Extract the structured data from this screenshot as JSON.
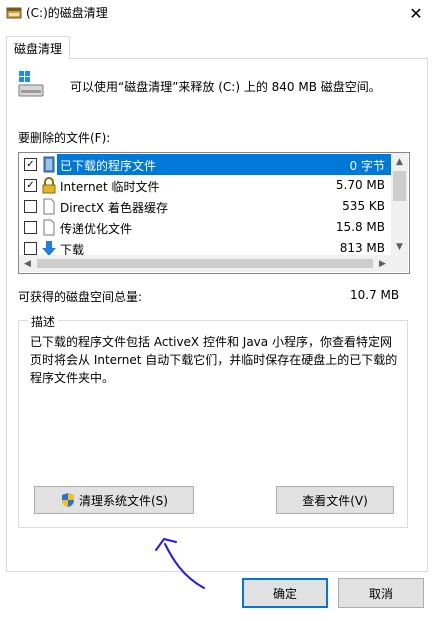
{
  "window": {
    "title": "(C:)的磁盘清理",
    "close_glyph": "✕"
  },
  "tabs": [
    {
      "label": "磁盘清理"
    }
  ],
  "header": {
    "text": "可以使用“磁盘清理”来释放 (C:) 上的 840 MB 磁盘空间。",
    "icon": "drive-icon"
  },
  "files": {
    "label": "要删除的文件(F):",
    "items": [
      {
        "name": "已下载的程序文件",
        "size": "0 字节",
        "checked": true,
        "selected": true,
        "icon": "folder-icon"
      },
      {
        "name": "Internet 临时文件",
        "size": "5.70 MB",
        "checked": true,
        "selected": false,
        "icon": "lock-icon"
      },
      {
        "name": "DirectX 着色器缓存",
        "size": "535 KB",
        "checked": false,
        "selected": false,
        "icon": "page-icon"
      },
      {
        "name": "传递优化文件",
        "size": "15.8 MB",
        "checked": false,
        "selected": false,
        "icon": "page-icon"
      },
      {
        "name": "下载",
        "size": "813 MB",
        "checked": false,
        "selected": false,
        "icon": "download-arrow-icon"
      }
    ]
  },
  "total": {
    "label": "可获得的磁盘空间总量:",
    "value": "10.7 MB"
  },
  "description": {
    "title": "描述",
    "text": "已下载的程序文件包括 ActiveX 控件和 Java 小程序，你查看特定网页时将会从 Internet 自动下载它们，并临时保存在硬盘上的已下载的程序文件夹中。"
  },
  "buttons": {
    "clean_system": "清理系统文件(S)",
    "view_files": "查看文件(V)",
    "ok": "确定",
    "cancel": "取消"
  },
  "colors": {
    "selection": "#0078d7",
    "annotation": "#1a1aff"
  }
}
